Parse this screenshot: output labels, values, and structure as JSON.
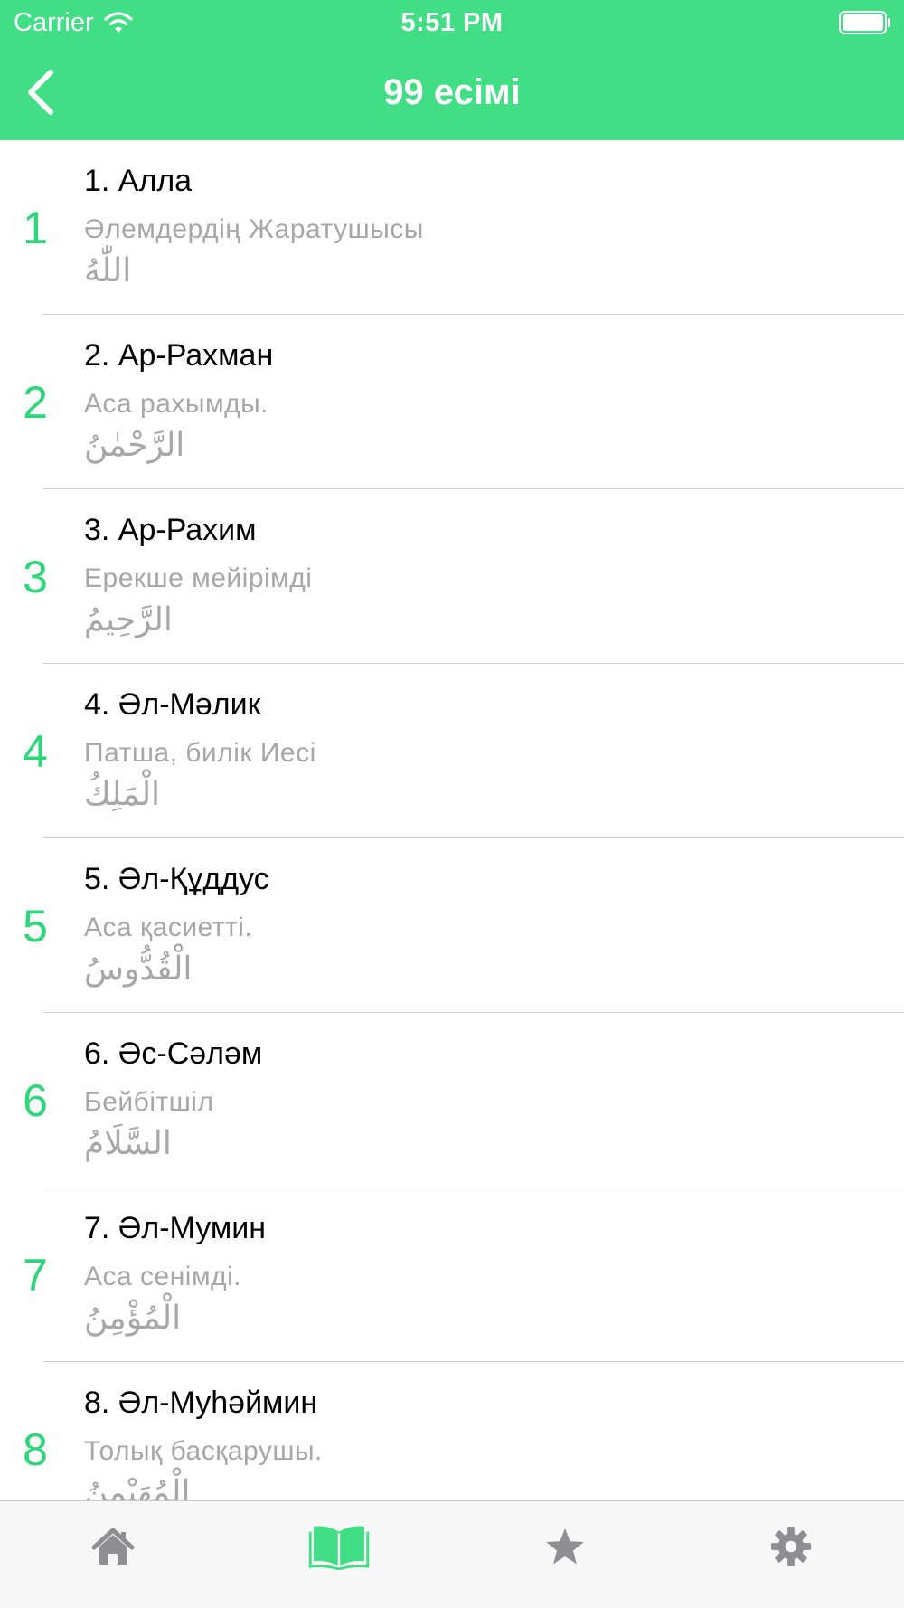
{
  "status_bar": {
    "carrier": "Carrier",
    "time": "5:51 PM"
  },
  "nav": {
    "title": "99 есімі",
    "back_icon": "chevron-left-icon"
  },
  "names": [
    {
      "number": "1",
      "title": "1. Алла",
      "meaning": "Әлемдердің Жаратушысы",
      "arabic": "اللّٰهُ"
    },
    {
      "number": "2",
      "title": "2. Ар-Рахман",
      "meaning": "Аса рахымды.",
      "arabic": "الرَّحْمٰنُ"
    },
    {
      "number": "3",
      "title": "3. Ар-Рахим",
      "meaning": "Ерекше мейірімді",
      "arabic": "الرَّحِيمُ"
    },
    {
      "number": "4",
      "title": "4. Әл-Мәлик",
      "meaning": "Патша, билік Иесі",
      "arabic": "الْمَلِكُ"
    },
    {
      "number": "5",
      "title": "5. Әл-Құддус",
      "meaning": "Аса қасиетті.",
      "arabic": "الْقُدُّوسُ"
    },
    {
      "number": "6",
      "title": "6. Әс-Сәләм",
      "meaning": "Бейбітшіл",
      "arabic": "السَّلَامُ"
    },
    {
      "number": "7",
      "title": "7. Әл-Мумин",
      "meaning": "Аса сенімді.",
      "arabic": "الْمُؤْمِنُ"
    },
    {
      "number": "8",
      "title": "8. Әл-Муһәймин",
      "meaning": "Толық басқарушы.",
      "arabic": "الْمُهَيْمِنُ"
    }
  ],
  "tabs": [
    {
      "icon": "home-icon",
      "active": false
    },
    {
      "icon": "book-icon",
      "active": true
    },
    {
      "icon": "star-icon",
      "active": false
    },
    {
      "icon": "gear-icon",
      "active": false
    }
  ],
  "colors": {
    "accent": "#42de85",
    "number": "#2fd57a",
    "inactive_tab": "#8e8e93",
    "secondary_text": "#a7a7a7"
  }
}
